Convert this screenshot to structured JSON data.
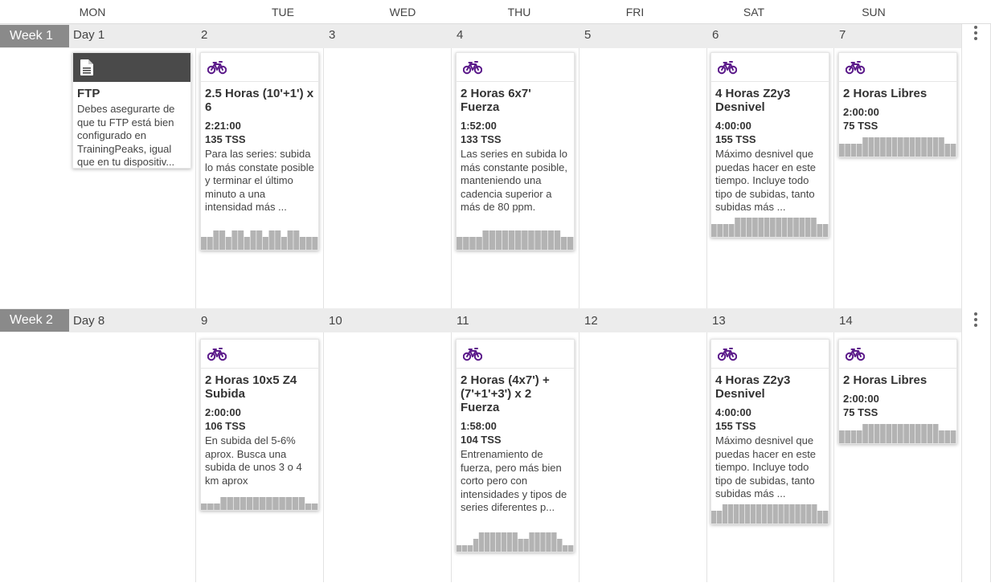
{
  "day_headers": [
    "MON",
    "TUE",
    "WED",
    "THU",
    "FRI",
    "SAT",
    "SUN"
  ],
  "weeks": [
    {
      "label": "Week 1",
      "day_numbers": [
        "Day 1",
        "2",
        "3",
        "4",
        "5",
        "6",
        "7"
      ],
      "cards": {
        "ftp": {
          "icon": "document-icon",
          "title": "FTP",
          "desc": "Debes asegurarte de que tu FTP está bien configurado en TrainingPeaks, igual que en tu dispositiv..."
        },
        "tue": {
          "icon": "bike-icon",
          "title": "2.5 Horas (10'+1') x 6",
          "duration": "2:21:00",
          "tss": "135 TSS",
          "desc": "Para las series: subida lo más constate posible y terminar el último minuto a una intensidad más ..."
        },
        "thu": {
          "icon": "bike-icon",
          "title": "2 Horas 6x7' Fuerza",
          "duration": "1:52:00",
          "tss": "133 TSS",
          "desc": "Las series en subida lo más constante posible, manteniendo una cadencia superior a más de 80 ppm."
        },
        "sat": {
          "icon": "bike-icon",
          "title": "4 Horas Z2y3 Desnivel",
          "duration": "4:00:00",
          "tss": "155 TSS",
          "desc": "Máximo desnivel que puedas hacer en este tiempo. Incluye todo tipo de subidas, tanto subidas más ..."
        },
        "sun": {
          "icon": "bike-icon",
          "title": "2 Horas Libres",
          "duration": "2:00:00",
          "tss": "75 TSS"
        }
      }
    },
    {
      "label": "Week 2",
      "day_numbers": [
        "Day 8",
        "9",
        "10",
        "11",
        "12",
        "13",
        "14"
      ],
      "cards": {
        "tue": {
          "icon": "bike-icon",
          "title": "2 Horas 10x5 Z4 Subida",
          "duration": "2:00:00",
          "tss": "106 TSS",
          "desc": "En subida del 5-6% aprox. Busca una subida de unos 3 o 4 km aprox"
        },
        "thu": {
          "icon": "bike-icon",
          "title": "2 Horas (4x7') + (7'+1'+3') x 2 Fuerza",
          "duration": "1:58:00",
          "tss": "104 TSS",
          "desc": "Entrenamiento de fuerza, pero más bien corto pero con intensidades y tipos de series diferentes p..."
        },
        "sat": {
          "icon": "bike-icon",
          "title": "4 Horas Z2y3 Desnivel",
          "duration": "4:00:00",
          "tss": "155 TSS",
          "desc": "Máximo desnivel que puedas hacer en este tiempo. Incluye todo tipo de subidas, tanto subidas más ..."
        },
        "sun": {
          "icon": "bike-icon",
          "title": "2 Horas Libres",
          "duration": "2:00:00",
          "tss": "75 TSS"
        }
      }
    }
  ],
  "colors": {
    "bike_icon": "#5b1a8a",
    "week_label_bg": "#8a8a8a",
    "week_bar_bg": "#ececec",
    "graph_fill": "#b3b3b3",
    "ftp_header_bg": "#4a4a4a"
  },
  "menu_icon": "more-vertical-icon",
  "workout_profiles": {
    "w1_tue": [
      2,
      2,
      3,
      3,
      2,
      3,
      3,
      2,
      3,
      3,
      2,
      3,
      3,
      2,
      3,
      3,
      2,
      2,
      2
    ],
    "w1_thu": [
      2,
      2,
      2,
      2,
      3,
      3,
      3,
      3,
      3,
      3,
      3,
      3,
      3,
      3,
      3,
      3,
      2,
      2
    ],
    "w1_sat": [
      2,
      2,
      2,
      2,
      3,
      3,
      3,
      3,
      3,
      3,
      3,
      3,
      3,
      3,
      3,
      3,
      3,
      3,
      2,
      2
    ],
    "w1_sun": [
      2,
      2,
      2,
      2,
      3,
      3,
      3,
      3,
      3,
      3,
      3,
      3,
      3,
      3,
      3,
      3,
      3,
      3,
      2,
      2
    ],
    "w2_tue": [
      1,
      1,
      1,
      2,
      2,
      2,
      2,
      2,
      2,
      2,
      2,
      2,
      2,
      2,
      2,
      2,
      1,
      1
    ],
    "w2_thu": [
      1,
      1,
      1,
      2,
      3,
      3,
      3,
      3,
      3,
      3,
      3,
      2,
      2,
      3,
      3,
      3,
      3,
      3,
      2,
      1,
      1
    ],
    "w2_sat": [
      2,
      2,
      3,
      3,
      3,
      3,
      3,
      3,
      3,
      3,
      3,
      3,
      3,
      3,
      3,
      3,
      3,
      3,
      3,
      2,
      2
    ],
    "w2_sun": [
      2,
      2,
      2,
      2,
      3,
      3,
      3,
      3,
      3,
      3,
      3,
      3,
      3,
      3,
      3,
      3,
      3,
      2,
      2,
      2
    ]
  }
}
